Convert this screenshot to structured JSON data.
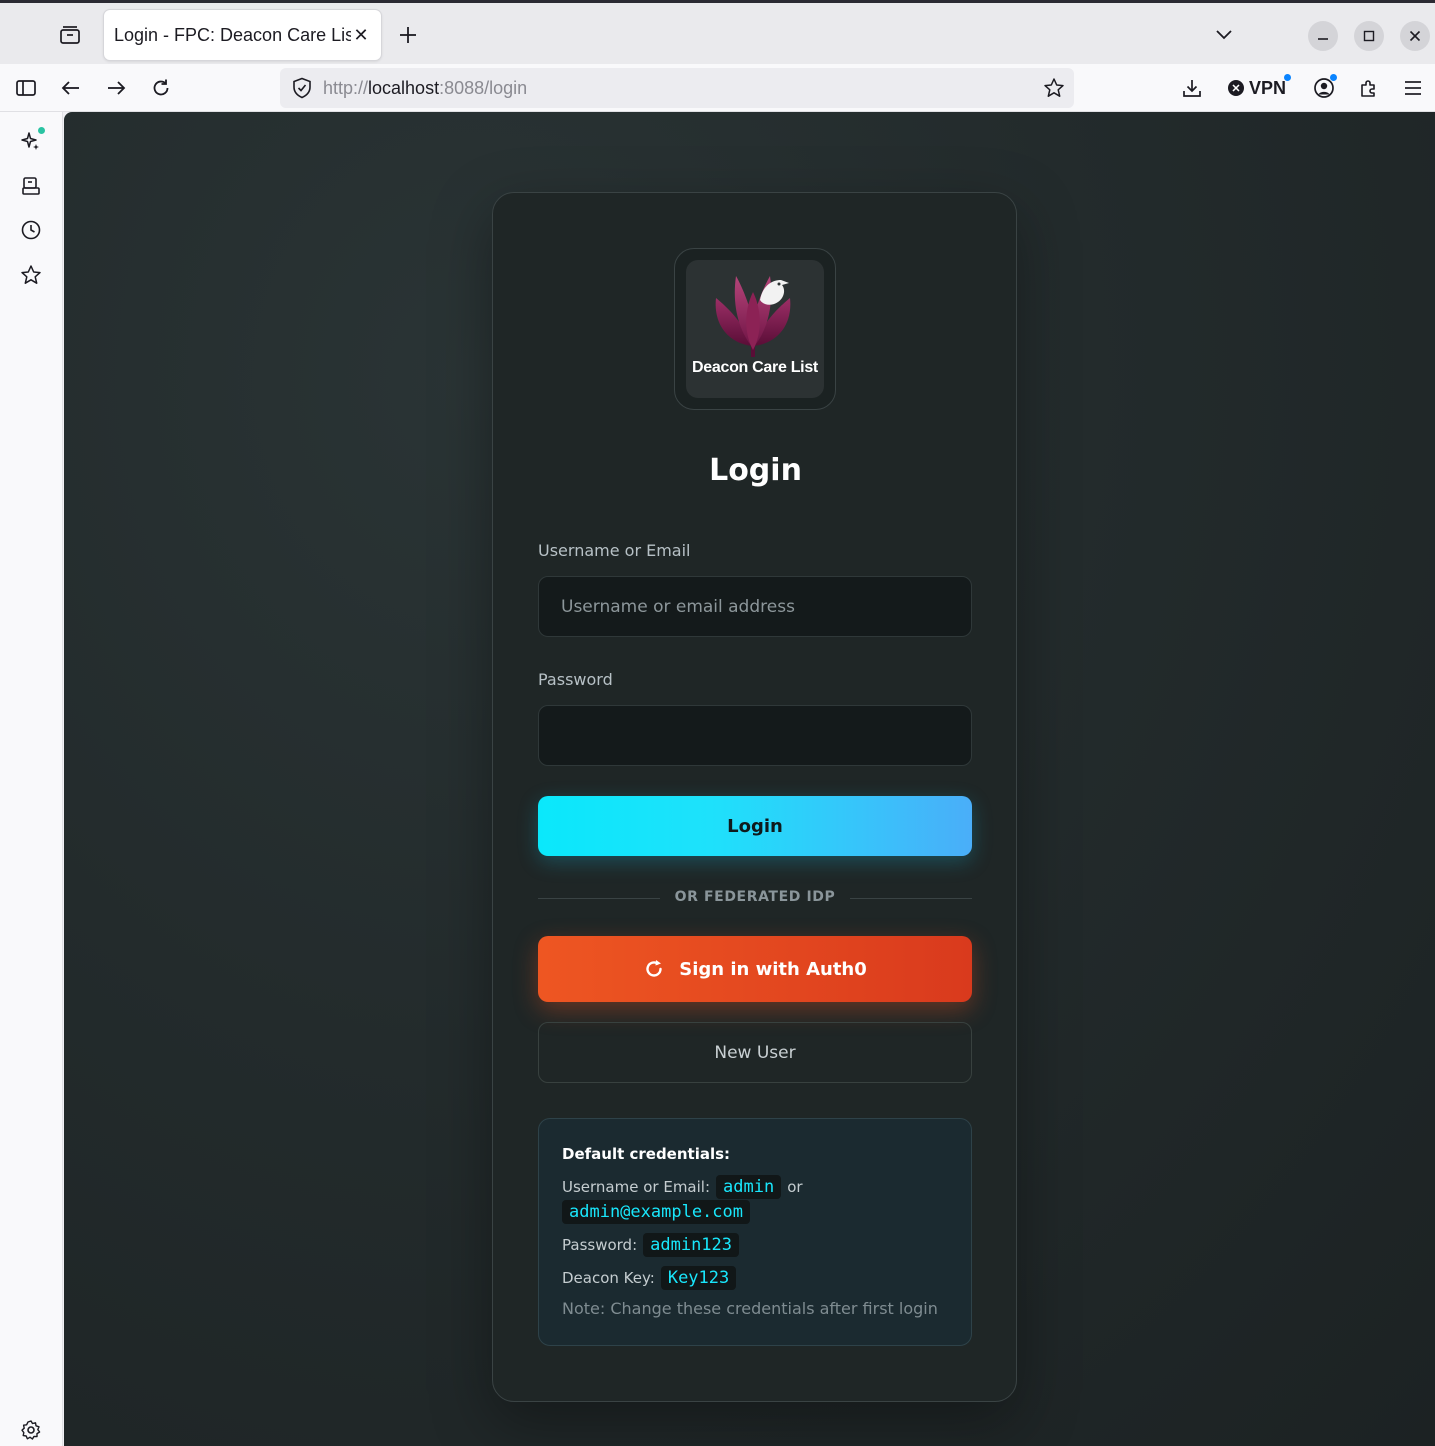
{
  "browser": {
    "tab_title": "Login - FPC: Deacon Care List",
    "url_scheme": "http://",
    "url_host": "localhost",
    "url_rest": ":8088/login",
    "vpn_label": "VPN"
  },
  "logo": {
    "text": "Deacon Care List"
  },
  "login": {
    "title": "Login",
    "username_label": "Username or Email",
    "username_placeholder": "Username or email address",
    "username_value": "",
    "password_label": "Password",
    "password_value": "",
    "login_button": "Login",
    "divider_text": "OR FEDERATED IDP",
    "auth0_button": "Sign in with Auth0",
    "new_user_button": "New User"
  },
  "credentials": {
    "heading": "Default credentials:",
    "username_label": "Username or Email:",
    "username_value": "admin",
    "or_text": "or",
    "email_value": "admin@example.com",
    "password_label": "Password:",
    "password_value": "admin123",
    "key_label": "Deacon Key:",
    "key_value": "Key123",
    "note": "Note: Change these credentials after first login"
  },
  "colors": {
    "accent_cyan": "#0ae8fb",
    "accent_blue": "#4aaef9",
    "auth0_orange": "#ee5622",
    "background": "#232b2c",
    "code_text": "#19e6fb"
  }
}
